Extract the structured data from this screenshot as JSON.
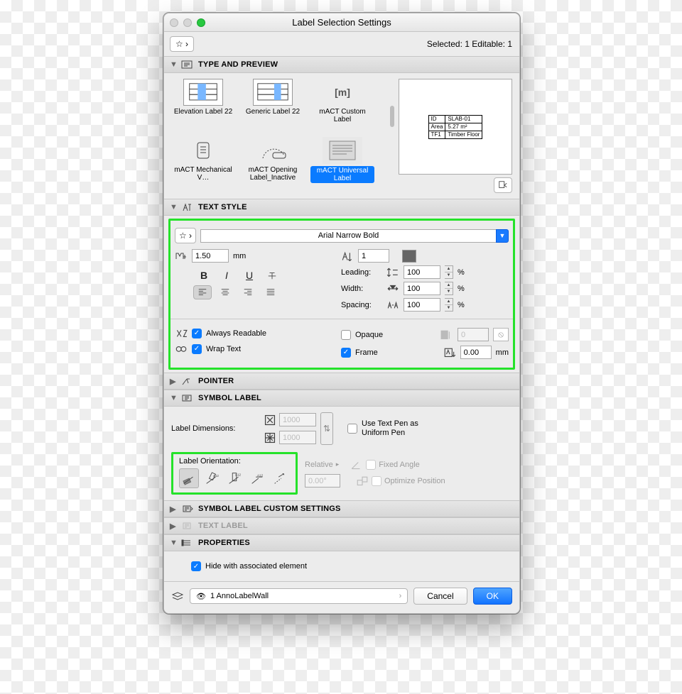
{
  "window": {
    "title": "Label Selection Settings"
  },
  "header": {
    "selected_text": "Selected: 1 Editable: 1"
  },
  "sections": {
    "type_preview": "TYPE AND PREVIEW",
    "text_style": "TEXT STYLE",
    "pointer": "POINTER",
    "symbol_label": "SYMBOL LABEL",
    "symbol_custom": "SYMBOL LABEL CUSTOM SETTINGS",
    "text_label": "TEXT LABEL",
    "properties": "PROPERTIES"
  },
  "tiles": [
    {
      "label": "Elevation Label 22"
    },
    {
      "label": "Generic Label 22"
    },
    {
      "label": "mACT Custom Label",
      "glyph": "[m]"
    },
    {
      "label": "mACT Mechanical V…"
    },
    {
      "label": "mACT Opening Label_Inactive"
    },
    {
      "label": "mACT Universal Label",
      "selected": true
    }
  ],
  "preview_table": [
    [
      "ID",
      "SLAB-01"
    ],
    [
      "Area",
      "5.27 m²"
    ],
    [
      "TF1",
      "Timber Floor"
    ]
  ],
  "text_style": {
    "font": "Arial Narrow Bold",
    "size": "1.50",
    "size_unit": "mm",
    "pen": "1",
    "leading_label": "Leading:",
    "leading": "100",
    "width_label": "Width:",
    "width": "100",
    "spacing_label": "Spacing:",
    "spacing": "100",
    "percent": "%",
    "always_readable": "Always Readable",
    "wrap_text": "Wrap Text",
    "opaque": "Opaque",
    "frame": "Frame",
    "opaque_pen": "0",
    "frame_offset": "0.00",
    "frame_unit": "mm"
  },
  "symbol_label": {
    "dims_label": "Label Dimensions:",
    "w": "1000",
    "h": "1000",
    "use_text_pen": "Use Text Pen as Uniform Pen",
    "orientation_label": "Label Orientation:",
    "relative": "Relative",
    "rel_angle": "0.00°",
    "fixed_angle": "Fixed Angle",
    "optimize": "Optimize Position"
  },
  "properties": {
    "hide": "Hide with associated element"
  },
  "footer": {
    "layer": "1 AnnoLabelWall",
    "cancel": "Cancel",
    "ok": "OK"
  }
}
